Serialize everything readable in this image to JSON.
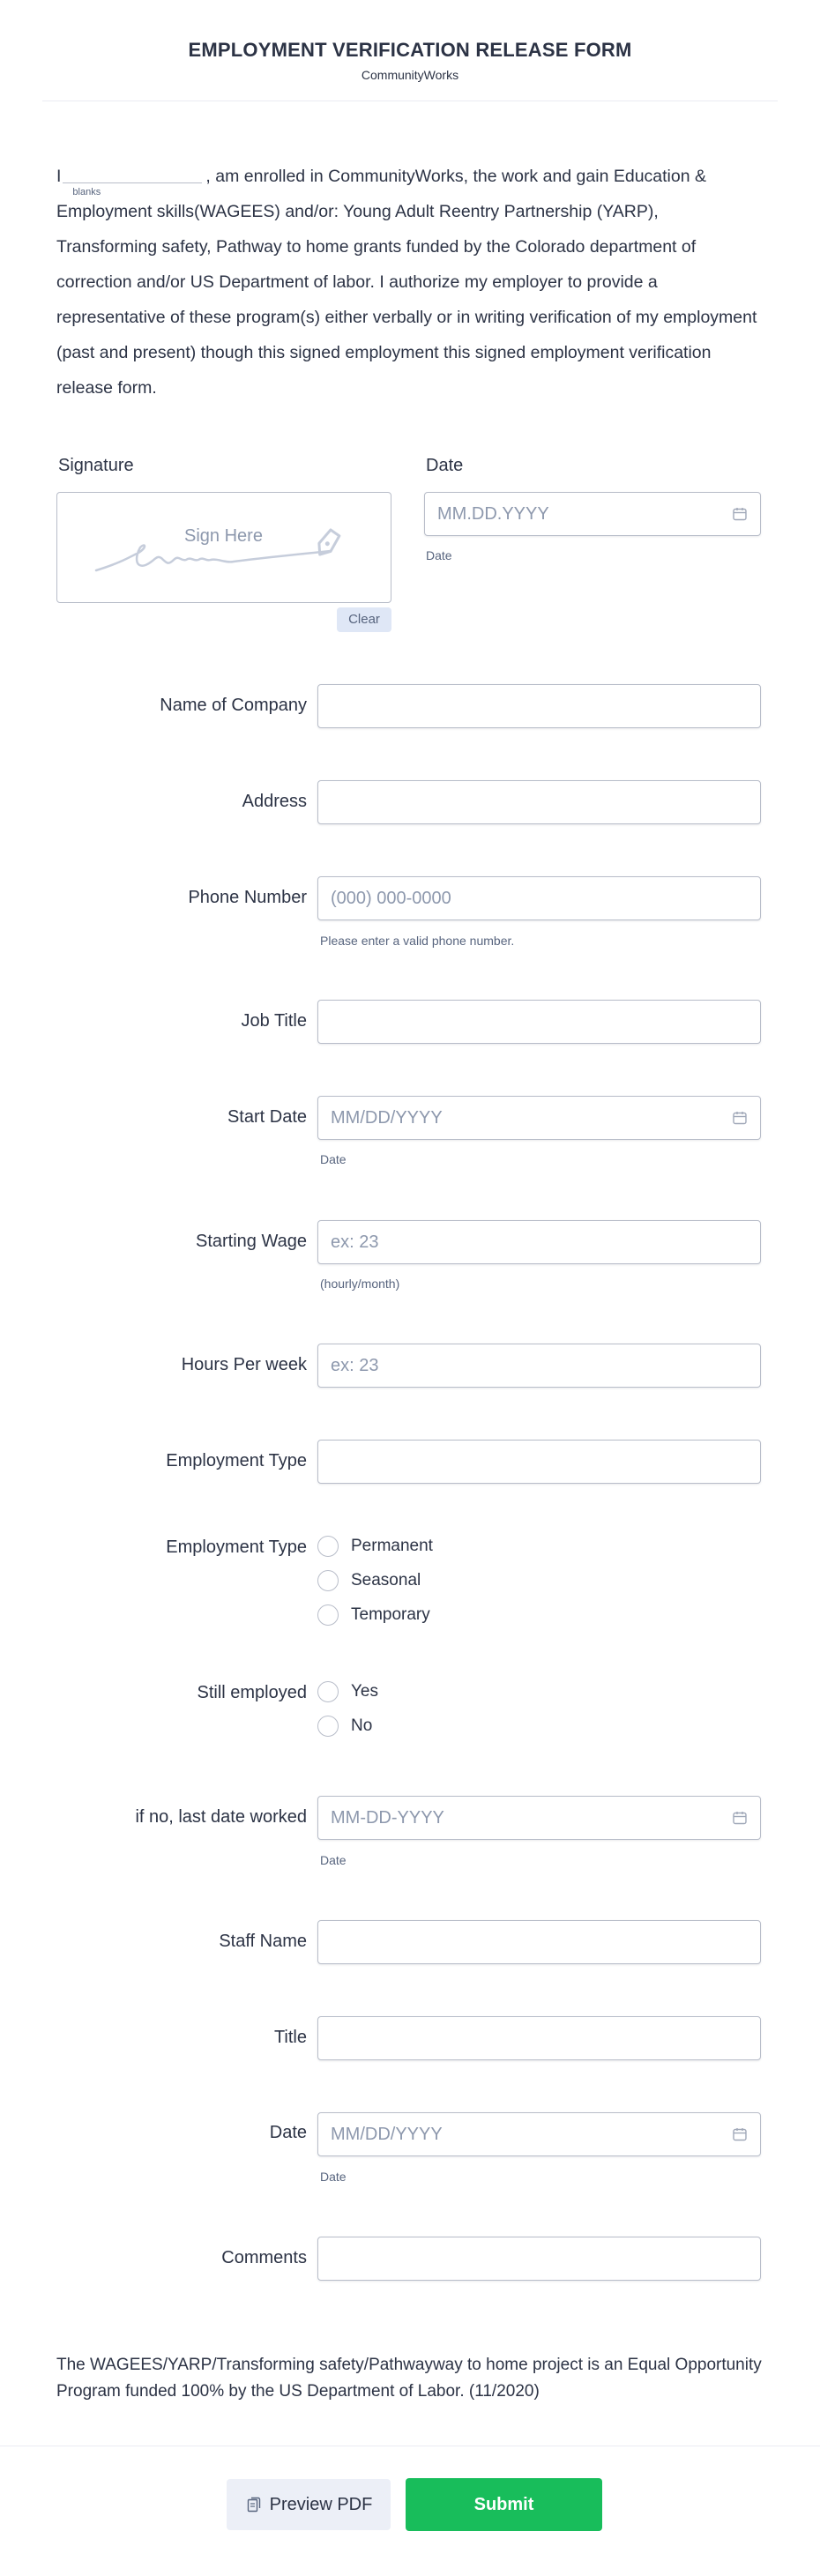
{
  "header": {
    "title": "EMPLOYMENT VERIFICATION RELEASE FORM",
    "subtitle": "CommunityWorks"
  },
  "intro": {
    "prefix": "I",
    "blank_label": "blanks",
    "blank_value": "",
    "text": ", am enrolled in CommunityWorks, the work and gain Education & Employment skills(WAGEES) and/or: Young Adult Reentry Partnership (YARP), Transforming safety, Pathway to home grants funded by the Colorado department of correction and/or US Department of labor. I authorize my employer to provide a representative of these program(s) either verbally or in writing verification of my employment (past and present) though this signed employment this signed employment verification release form."
  },
  "signature": {
    "label": "Signature",
    "hint": "Sign Here",
    "clear_label": "Clear"
  },
  "sig_date": {
    "label": "Date",
    "placeholder": "MM.DD.YYYY",
    "sublabel": "Date",
    "icon": "calendar-icon"
  },
  "fields": {
    "company": {
      "label": "Name of Company",
      "value": ""
    },
    "address": {
      "label": "Address",
      "value": ""
    },
    "phone": {
      "label": "Phone Number",
      "placeholder": "(000) 000-0000",
      "sublabel": "Please enter a valid phone number."
    },
    "job_title": {
      "label": "Job Title",
      "value": ""
    },
    "start_date": {
      "label": "Start Date",
      "placeholder": "MM/DD/YYYY",
      "sublabel": "Date"
    },
    "starting_wage": {
      "label": "Starting Wage",
      "placeholder": "ex: 23",
      "sublabel": "(hourly/month)"
    },
    "hours": {
      "label": "Hours Per week",
      "placeholder": "ex: 23"
    },
    "employment_type_text": {
      "label": "Employment Type",
      "value": ""
    },
    "employment_type_radio": {
      "label": "Employment Type",
      "options": [
        "Permanent",
        "Seasonal",
        "Temporary"
      ]
    },
    "still_employed": {
      "label": "Still employed",
      "options": [
        "Yes",
        "No"
      ]
    },
    "last_date": {
      "label": "if no, last date worked",
      "placeholder": "MM-DD-YYYY",
      "sublabel": "Date"
    },
    "staff_name": {
      "label": "Staff Name",
      "value": ""
    },
    "title": {
      "label": "Title",
      "value": ""
    },
    "date": {
      "label": "Date",
      "placeholder": "MM/DD/YYYY",
      "sublabel": "Date"
    },
    "comments": {
      "label": "Comments",
      "value": ""
    }
  },
  "footer": {
    "note": "The WAGEES/YARP/Transforming safety/Pathwayway to home project is an Equal Opportunity Program funded 100% by the US Department of Labor. (11/2020)",
    "preview_label": "Preview PDF",
    "submit_label": "Submit"
  },
  "colors": {
    "text": "#2c3345",
    "border": "#b8bdc9",
    "placeholder": "#8d98ad",
    "submit": "#18bd5b",
    "preview_bg": "#eceff7"
  }
}
